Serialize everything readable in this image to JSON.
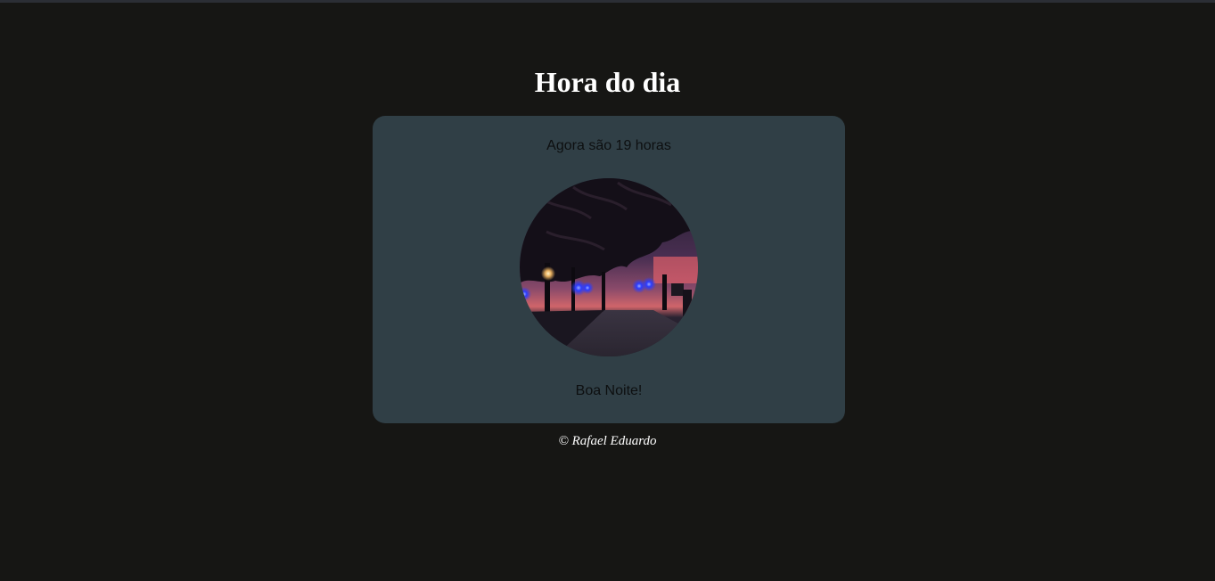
{
  "page": {
    "title": "Hora do dia",
    "background_color": "#161614"
  },
  "card": {
    "time_message": "Agora são 19 horas",
    "greeting": "Boa Noite!",
    "background_color": "#303f46",
    "photo_icon": "night-park-photo"
  },
  "footer": {
    "copyright": "© Rafael Eduardo"
  }
}
